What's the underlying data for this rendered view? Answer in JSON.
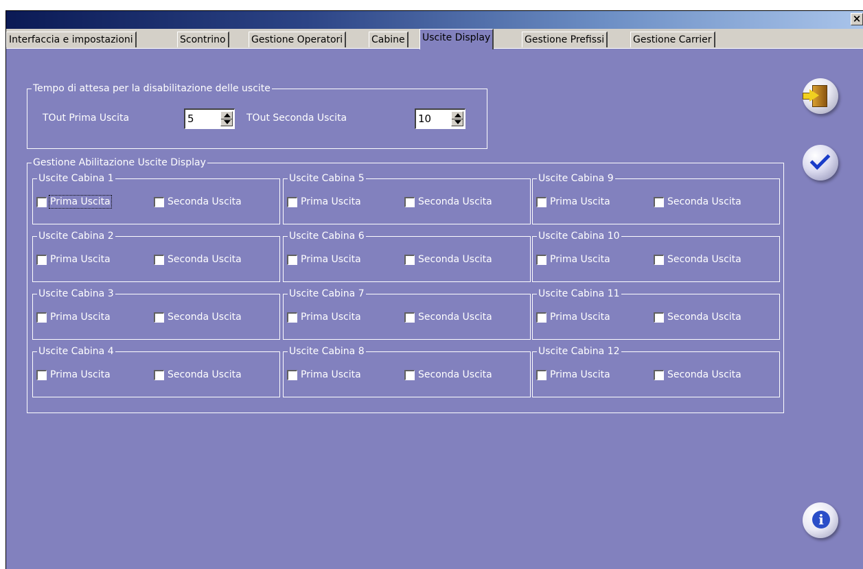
{
  "window": {
    "close_label": "×"
  },
  "tabs": [
    {
      "label": "Interfaccia  e impostazioni"
    },
    {
      "label": "Scontrino"
    },
    {
      "label": "Gestione Operatori"
    },
    {
      "label": "Cabine"
    },
    {
      "label": "Uscite Display"
    },
    {
      "label": "Gestione Prefissi"
    },
    {
      "label": "Gestione Carrier"
    }
  ],
  "active_tab": "Uscite Display",
  "timeout": {
    "legend": "Tempo di attesa per la disabilitazione delle uscite",
    "first_label": "TOut Prima Uscita",
    "first_value": "5",
    "second_label": "TOut Seconda Uscita",
    "second_value": "10"
  },
  "outputs": {
    "legend": "Gestione Abilitazione Uscite Display",
    "first_label": "Prima Uscita",
    "second_label": "Seconda Uscita",
    "cabins": [
      {
        "title": "Uscite Cabina 1",
        "first_checked": false,
        "second_checked": false
      },
      {
        "title": "Uscite Cabina 2",
        "first_checked": false,
        "second_checked": false
      },
      {
        "title": "Uscite Cabina 3",
        "first_checked": false,
        "second_checked": false
      },
      {
        "title": "Uscite Cabina 4",
        "first_checked": false,
        "second_checked": false
      },
      {
        "title": "Uscite Cabina 5",
        "first_checked": false,
        "second_checked": false
      },
      {
        "title": "Uscite Cabina 6",
        "first_checked": false,
        "second_checked": false
      },
      {
        "title": "Uscite Cabina 7",
        "first_checked": false,
        "second_checked": false
      },
      {
        "title": "Uscite Cabina 8",
        "first_checked": false,
        "second_checked": false
      },
      {
        "title": "Uscite Cabina 9",
        "first_checked": false,
        "second_checked": false
      },
      {
        "title": "Uscite Cabina 10",
        "first_checked": false,
        "second_checked": false
      },
      {
        "title": "Uscite Cabina 11",
        "first_checked": false,
        "second_checked": false
      },
      {
        "title": "Uscite Cabina 12",
        "first_checked": false,
        "second_checked": false
      }
    ]
  },
  "side_buttons": {
    "exit_icon": "door-exit-icon",
    "confirm_icon": "checkmark-icon",
    "info_icon": "info-icon",
    "info_glyph": "i"
  }
}
